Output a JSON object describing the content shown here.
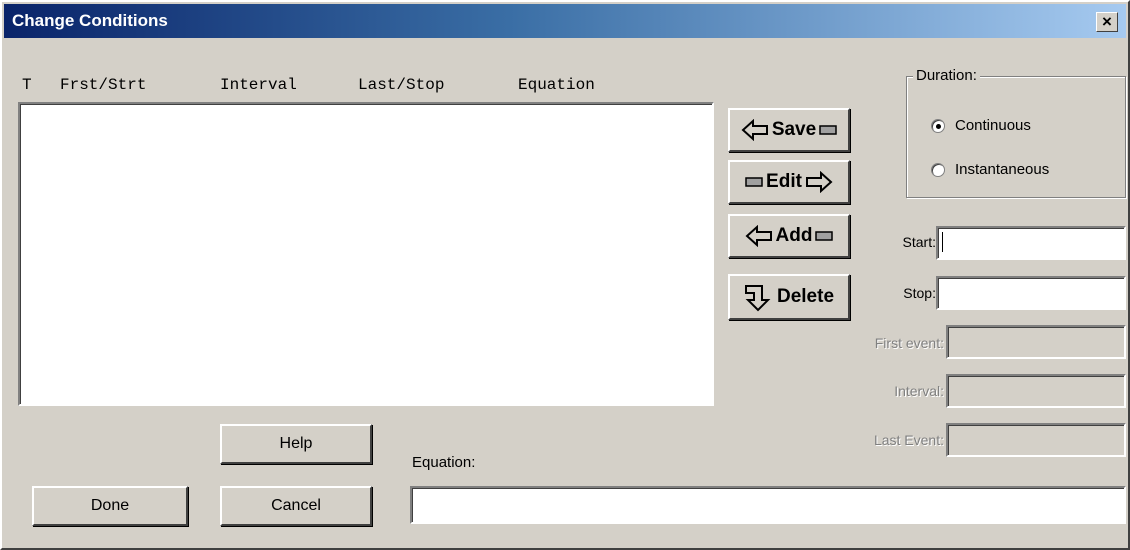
{
  "window": {
    "title": "Change Conditions",
    "close_symbol": "×"
  },
  "columns": {
    "type": "T",
    "first_start": "Frst/Strt",
    "interval": "Interval",
    "last_stop": "Last/Stop",
    "equation": "Equation"
  },
  "actions": {
    "save": "Save",
    "edit": "Edit",
    "add": "Add",
    "delete": "Delete"
  },
  "duration": {
    "legend": "Duration:",
    "options": [
      {
        "label": "Continuous",
        "selected": true
      },
      {
        "label": "Instantaneous",
        "selected": false
      }
    ]
  },
  "fields": {
    "start_label": "Start:",
    "start_value": "",
    "stop_label": "Stop:",
    "stop_value": "",
    "first_event_label": "First event:",
    "interval_label": "Interval:",
    "last_event_label": "Last Event:"
  },
  "equation": {
    "label": "Equation:",
    "value": ""
  },
  "buttons": {
    "help": "Help",
    "done": "Done",
    "cancel": "Cancel"
  },
  "colors": {
    "title_start": "#0a246a",
    "title_end": "#a6caf0",
    "face": "#d4d0c8"
  }
}
